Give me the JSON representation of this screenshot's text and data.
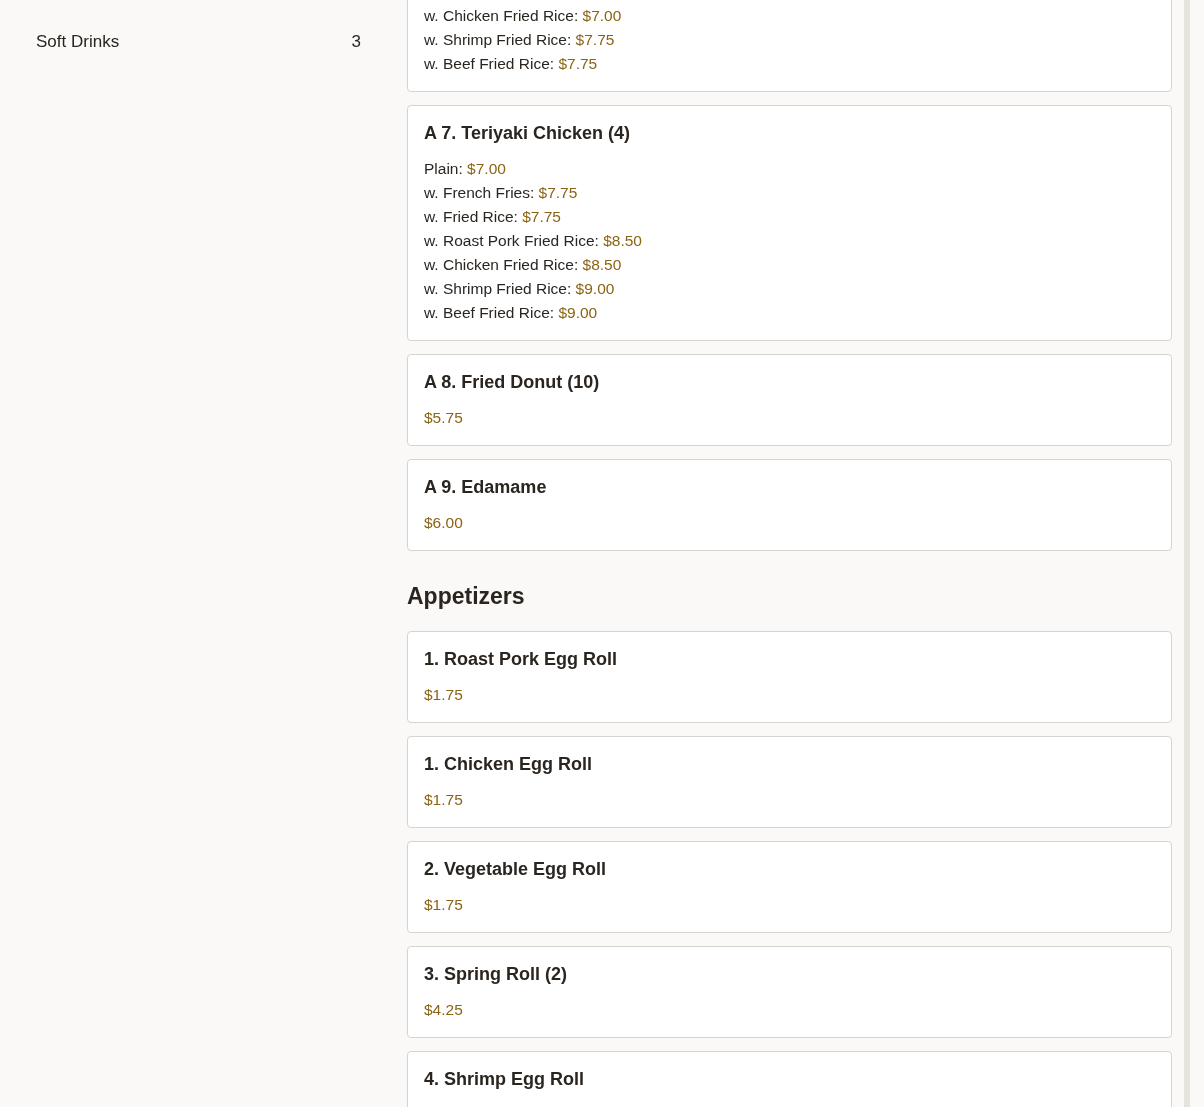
{
  "sidebar": {
    "items": [
      {
        "label": "Soft Drinks",
        "count": "3"
      }
    ]
  },
  "sections": [
    {
      "items": [
        {
          "options": [
            {
              "label": "w. Chicken Fried Rice:",
              "price": "$7.00"
            },
            {
              "label": "w. Shrimp Fried Rice:",
              "price": "$7.75"
            },
            {
              "label": "w. Beef Fried Rice:",
              "price": "$7.75"
            }
          ]
        },
        {
          "title": "A 7. Teriyaki Chicken (4)",
          "options": [
            {
              "label": "Plain:",
              "price": "$7.00"
            },
            {
              "label": "w. French Fries:",
              "price": "$7.75"
            },
            {
              "label": "w. Fried Rice:",
              "price": "$7.75"
            },
            {
              "label": "w. Roast Pork Fried Rice:",
              "price": "$8.50"
            },
            {
              "label": "w. Chicken Fried Rice:",
              "price": "$8.50"
            },
            {
              "label": "w. Shrimp Fried Rice:",
              "price": "$9.00"
            },
            {
              "label": "w. Beef Fried Rice:",
              "price": "$9.00"
            }
          ]
        },
        {
          "title": "A 8. Fried Donut (10)",
          "options": [
            {
              "price": "$5.75"
            }
          ]
        },
        {
          "title": "A 9. Edamame",
          "options": [
            {
              "price": "$6.00"
            }
          ]
        }
      ]
    },
    {
      "heading": "Appetizers",
      "items": [
        {
          "title": "1. Roast Pork Egg Roll",
          "options": [
            {
              "price": "$1.75"
            }
          ]
        },
        {
          "title": "1. Chicken Egg Roll",
          "options": [
            {
              "price": "$1.75"
            }
          ]
        },
        {
          "title": "2. Vegetable Egg Roll",
          "options": [
            {
              "price": "$1.75"
            }
          ]
        },
        {
          "title": "3. Spring Roll (2)",
          "options": [
            {
              "price": "$4.25"
            }
          ]
        },
        {
          "title": "4. Shrimp Egg Roll"
        }
      ]
    }
  ]
}
